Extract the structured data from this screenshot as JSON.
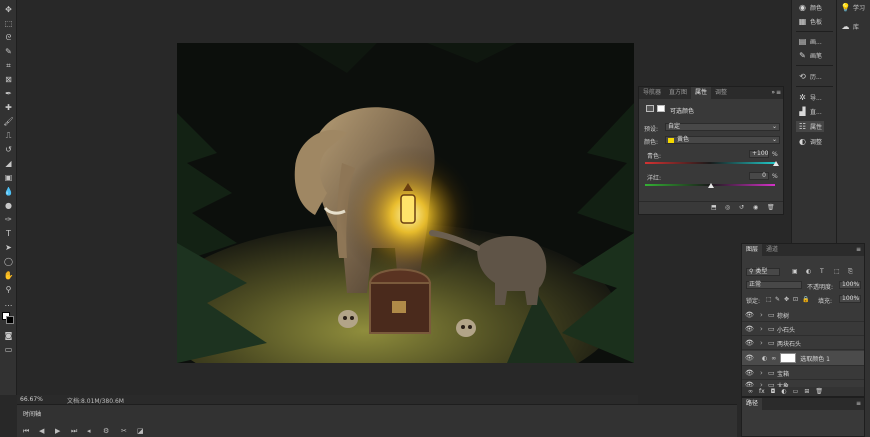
{
  "left_toolbar": {
    "tools": [
      "move-tool",
      "marquee-tool",
      "lasso-tool",
      "quick-select-tool",
      "crop-tool",
      "frame-tool",
      "eyedropper-tool",
      "healing-brush-tool",
      "brush-tool",
      "clone-stamp-tool",
      "history-brush-tool",
      "eraser-tool",
      "gradient-tool",
      "blur-tool",
      "dodge-tool",
      "pen-tool",
      "type-tool",
      "path-select-tool",
      "shape-tool",
      "hand-tool",
      "zoom-tool",
      "more-tools"
    ]
  },
  "status": {
    "zoom": "66.67%",
    "doc": "文档:8.01M/380.6M"
  },
  "timeline": {
    "title": "时间轴"
  },
  "dock_right": {
    "color": "颜色",
    "swatches": "色板",
    "learn": "学习",
    "libraries": "库"
  },
  "dock_mid": {
    "brush_settings": "画...",
    "brushes": "画笔",
    "history": "历...",
    "navigator": "导...",
    "histogram": "直...",
    "properties": "属性",
    "adjustments": "调整"
  },
  "properties_panel": {
    "tabs": [
      "导航器",
      "直方图",
      "属性",
      "调整"
    ],
    "active_tab": "属性",
    "title": "可选颜色",
    "preset_label": "预设:",
    "preset_value": "自定",
    "colors_label": "颜色:",
    "colors_value": "黄色",
    "colors_swatch": "#f5d800",
    "cyan_label": "青色:",
    "cyan_value": "+100",
    "cyan_unit": "%",
    "magenta_label": "洋红:",
    "magenta_value": "0",
    "magenta_unit": "%"
  },
  "layers_panel": {
    "tabs": [
      "图层",
      "通道"
    ],
    "kind_label": "类型",
    "blend_mode": "正常",
    "opacity_label": "不透明度:",
    "opacity_value": "100%",
    "lock_label": "锁定:",
    "fill_label": "填充:",
    "fill_value": "100%",
    "layers": [
      "棕树",
      "小石头",
      "两块石头",
      "选取颜色 1",
      "宝箱",
      "大象"
    ]
  },
  "paths_panel": {
    "title": "路径"
  },
  "colors": {
    "accent": "#f5d800",
    "panel": "#393939",
    "dark": "#282828"
  }
}
